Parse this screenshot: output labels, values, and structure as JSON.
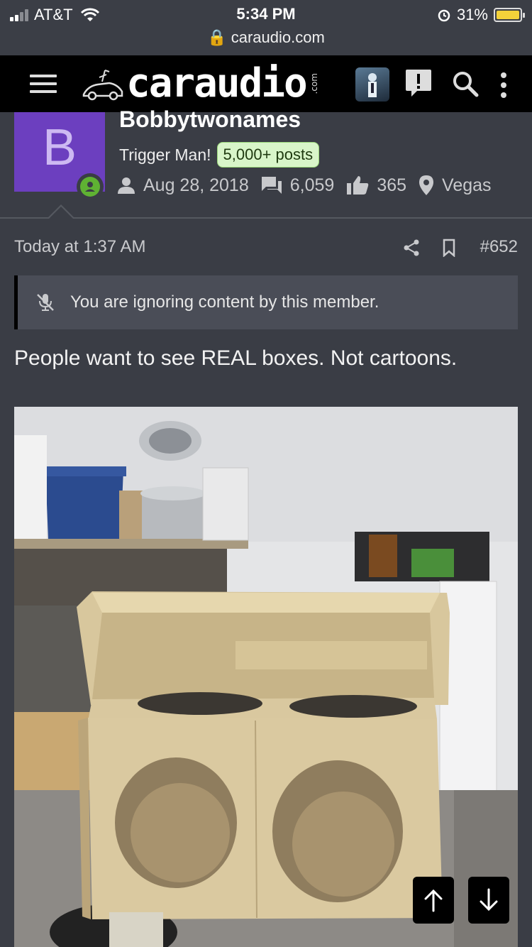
{
  "status_bar": {
    "carrier": "AT&T",
    "time": "5:34 PM",
    "url": "caraudio.com",
    "battery_percent": "31%",
    "battery_level": 0.31
  },
  "header": {
    "logo_text": "caraudio",
    "logo_suffix": ".com",
    "icons": [
      "menu-icon",
      "user-avatar",
      "alert-icon",
      "search-icon",
      "more-icon"
    ]
  },
  "member": {
    "avatar_letter": "B",
    "username": "Bobbytwonames",
    "title": "Trigger Man!",
    "posts_badge": "5,000+ posts",
    "joined": "Aug 28, 2018",
    "messages": "6,059",
    "reactions": "365",
    "location": "Vegas",
    "online": true,
    "avatar_color": "#6c3fbf"
  },
  "post": {
    "date": "Today at 1:37 AM",
    "number": "#652",
    "ignore_notice": "You are ignoring content by this member.",
    "text": "People want to see REAL boxes. Not cartoons.",
    "photo_alt": ""
  },
  "colors": {
    "background": "#3a3d45",
    "header": "#000000",
    "badge_bg": "#d8f5c9",
    "online": "#5fb233"
  }
}
